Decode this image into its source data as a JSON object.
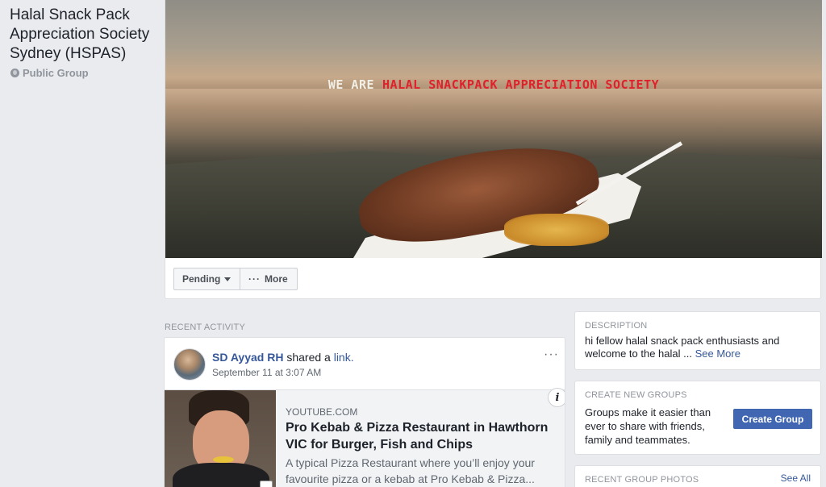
{
  "group": {
    "name": "Halal Snack Pack Appreciation Society Sydney (HSPAS)",
    "privacy": "Public Group"
  },
  "cover": {
    "banner_white": "WE ARE",
    "banner_red": "HALAL SNACKPACK APPRECIATION SOCIETY"
  },
  "actions": {
    "pending": "Pending",
    "more": "More"
  },
  "recent_activity": {
    "label": "RECENT ACTIVITY",
    "post": {
      "author": "SD Ayyad RH",
      "action": "shared a",
      "link_word": "link.",
      "time": "September 11 at 3:07 AM",
      "preview": {
        "domain": "YOUTUBE.COM",
        "title": "Pro Kebab & Pizza Restaurant in Hawthorn VIC for Burger, Fish and Chips",
        "description": "A typical Pizza Restaurant where you’ll enjoy your favourite pizza or a kebab at Pro Kebab & Pizza..."
      }
    }
  },
  "sidebar": {
    "description": {
      "label": "DESCRIPTION",
      "text": "hi fellow halal snack pack enthusiasts and welcome to the halal ...",
      "see_more": "See More"
    },
    "create_groups": {
      "label": "CREATE NEW GROUPS",
      "text": "Groups make it easier than ever to share with friends, family and teammates.",
      "button": "Create Group"
    },
    "photos": {
      "label": "RECENT GROUP PHOTOS",
      "see_all": "See All"
    }
  },
  "colors": {
    "link_blue": "#365899",
    "button_blue": "#4267b2",
    "banner_red": "#e0202a",
    "page_bg": "#e9ebee"
  }
}
